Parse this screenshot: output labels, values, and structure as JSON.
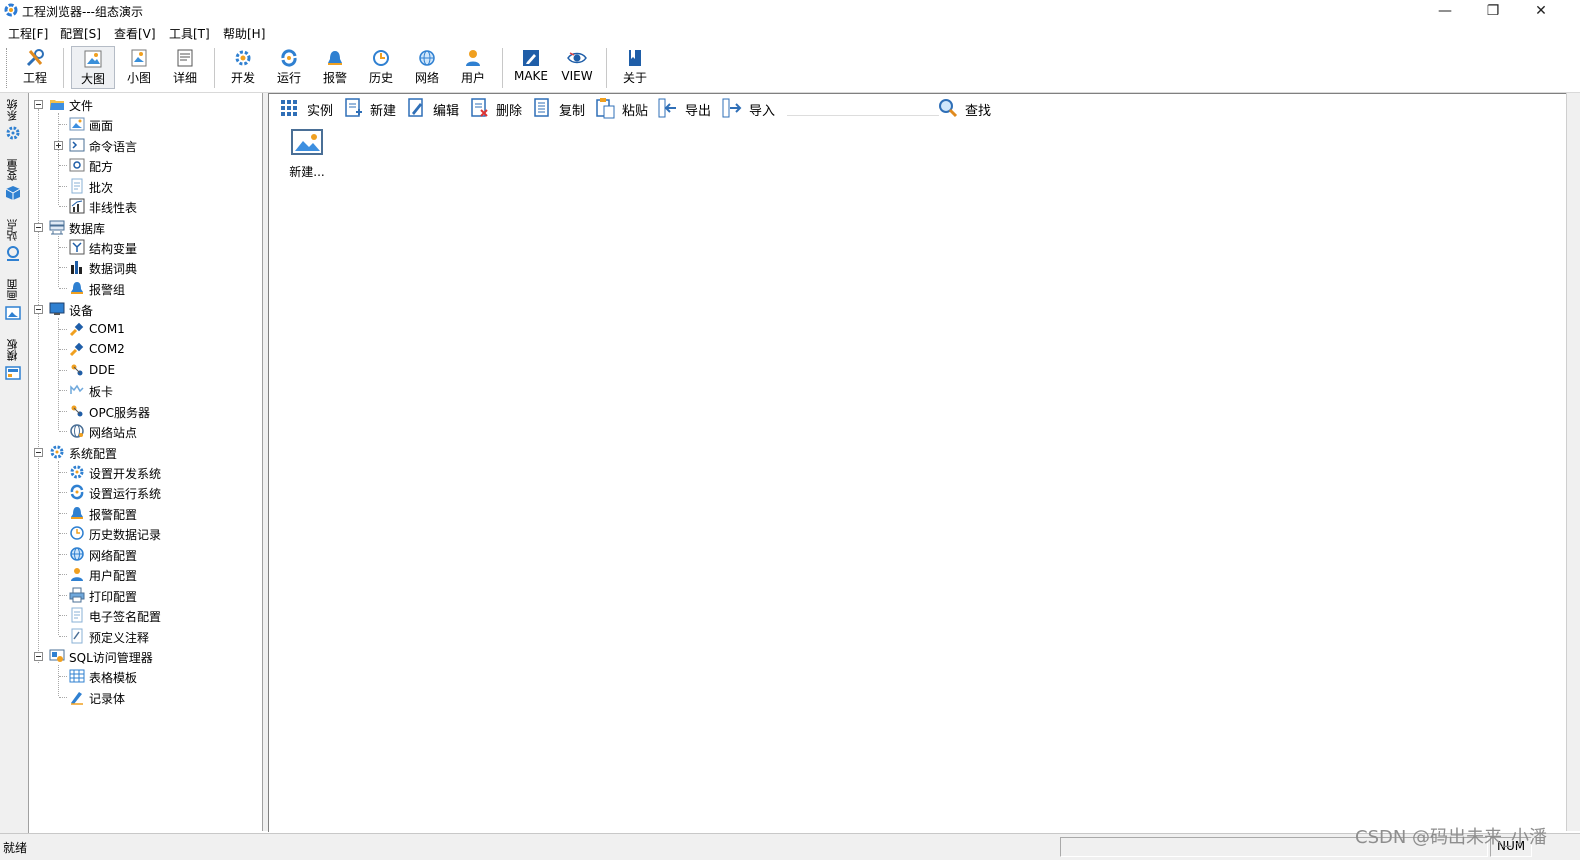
{
  "window": {
    "title": "工程浏览器---组态演示",
    "minimize": "—",
    "restore": "❐",
    "close": "✕"
  },
  "menu": [
    "工程[F]",
    "配置[S]",
    "查看[V]",
    "工具[T]",
    "帮助[H]"
  ],
  "toolbar": {
    "project": "工程",
    "large_icons": "大图",
    "small_icons": "小图",
    "details": "详细",
    "develop": "开发",
    "run": "运行",
    "alarm": "报警",
    "history": "历史",
    "network": "网络",
    "user": "用户",
    "make": "MAKE",
    "view": "VIEW",
    "about": "关于"
  },
  "side_tabs": [
    "系统",
    "变量",
    "站点",
    "画面",
    "模板"
  ],
  "tree": {
    "file": "文件",
    "screen": "画面",
    "command_lang": "命令语言",
    "recipe": "配方",
    "batch": "批次",
    "nonlinear": "非线性表",
    "database": "数据库",
    "struct_var": "结构变量",
    "data_dict": "数据词典",
    "alarm_group": "报警组",
    "device": "设备",
    "com1": "COM1",
    "com2": "COM2",
    "dde": "DDE",
    "board": "板卡",
    "opc": "OPC服务器",
    "net_station": "网络站点",
    "sys_config": "系统配置",
    "set_dev": "设置开发系统",
    "set_run": "设置运行系统",
    "alarm_cfg": "报警配置",
    "hist_rec": "历史数据记录",
    "net_cfg": "网络配置",
    "user_cfg": "用户配置",
    "print_cfg": "打印配置",
    "esign_cfg": "电子签名配置",
    "predef_note": "预定义注释",
    "sql": "SQL访问管理器",
    "table_tpl": "表格模板",
    "record": "记录体"
  },
  "content_toolbar": {
    "instance": "实例",
    "new": "新建",
    "edit": "编辑",
    "delete": "删除",
    "copy": "复制",
    "paste": "粘贴",
    "export": "导出",
    "import": "导入",
    "search_value": "",
    "find": "查找"
  },
  "content": {
    "new_item": "新建..."
  },
  "status": {
    "text": "就绪",
    "num": "NUM"
  },
  "watermark": "CSDN @码出未来_小潘"
}
